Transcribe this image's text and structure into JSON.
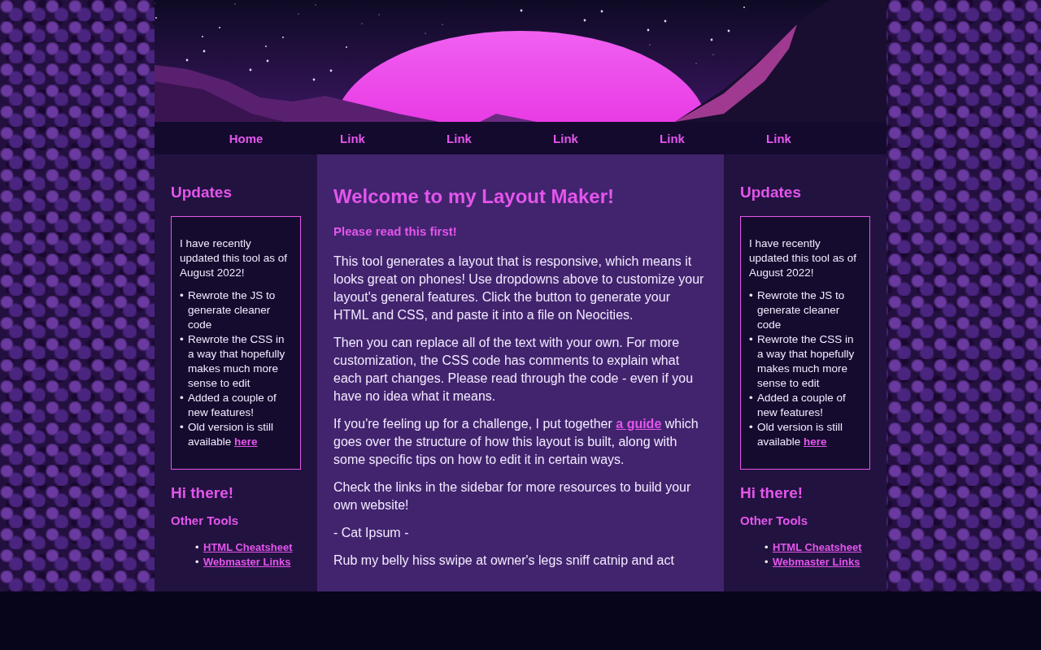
{
  "nav": [
    "Home",
    "Link",
    "Link",
    "Link",
    "Link",
    "Link"
  ],
  "sidebars": [
    {
      "title": "Updates",
      "box": {
        "intro": "I have recently updated this tool as of August 2022!",
        "items": [
          {
            "bullet": "•",
            "text": "Rewrote the JS to generate cleaner code"
          },
          {
            "bullet": "•",
            "text": "Rewrote the CSS in a way that hopefully makes much more sense to edit"
          },
          {
            "bullet": "•",
            "text": "Added a couple of new features!"
          },
          {
            "bullet": "•",
            "text": "Old version is still available",
            "link": "here"
          }
        ]
      },
      "heading": "Hi there!",
      "subheading": "Other Tools",
      "links": [
        {
          "bullet": "•",
          "text": "HTML Cheatsheet"
        },
        {
          "bullet": "•",
          "text": "Webmaster Links"
        }
      ]
    },
    {
      "title": "Updates",
      "box": {
        "intro": "I have recently updated this tool as of August 2022!",
        "items": [
          {
            "bullet": "•",
            "text": "Rewrote the JS to generate cleaner code"
          },
          {
            "bullet": "•",
            "text": "Rewrote the CSS in a way that hopefully makes much more sense to edit"
          },
          {
            "bullet": "•",
            "text": "Added a couple of new features!"
          },
          {
            "bullet": "•",
            "text": "Old version is still available",
            "link": "here"
          }
        ]
      },
      "heading": "Hi there!",
      "subheading": "Other Tools",
      "links": [
        {
          "bullet": "•",
          "text": "HTML Cheatsheet"
        },
        {
          "bullet": "•",
          "text": "Webmaster Links"
        }
      ]
    }
  ],
  "main": {
    "title": "Welcome to my Layout Maker!",
    "lead": "Please read this first!",
    "paragraphs": [
      {
        "text": "This tool generates a layout that is responsive, which means it looks great on phones! Use dropdowns above to customize your layout's general features. Click the button to generate your HTML and CSS, and paste it into a file on Neocities."
      },
      {
        "text": "Then you can replace all of the text with your own. For more customization, the CSS code has comments to explain what each part changes. Please read through the code - even if you have no idea what it means."
      },
      {
        "text": "If you're feeling up for a challenge, I put together",
        "link": "a guide",
        "after": "which goes over the structure of how this layout is built, along with some specific tips on how to edit it in certain ways."
      },
      {
        "text": "Check the links in the sidebar for more resources to build your own website!"
      },
      {
        "text": "- Cat Ipsum -"
      },
      {
        "text": "Rub my belly hiss swipe at owner's legs sniff catnip and act"
      }
    ]
  }
}
